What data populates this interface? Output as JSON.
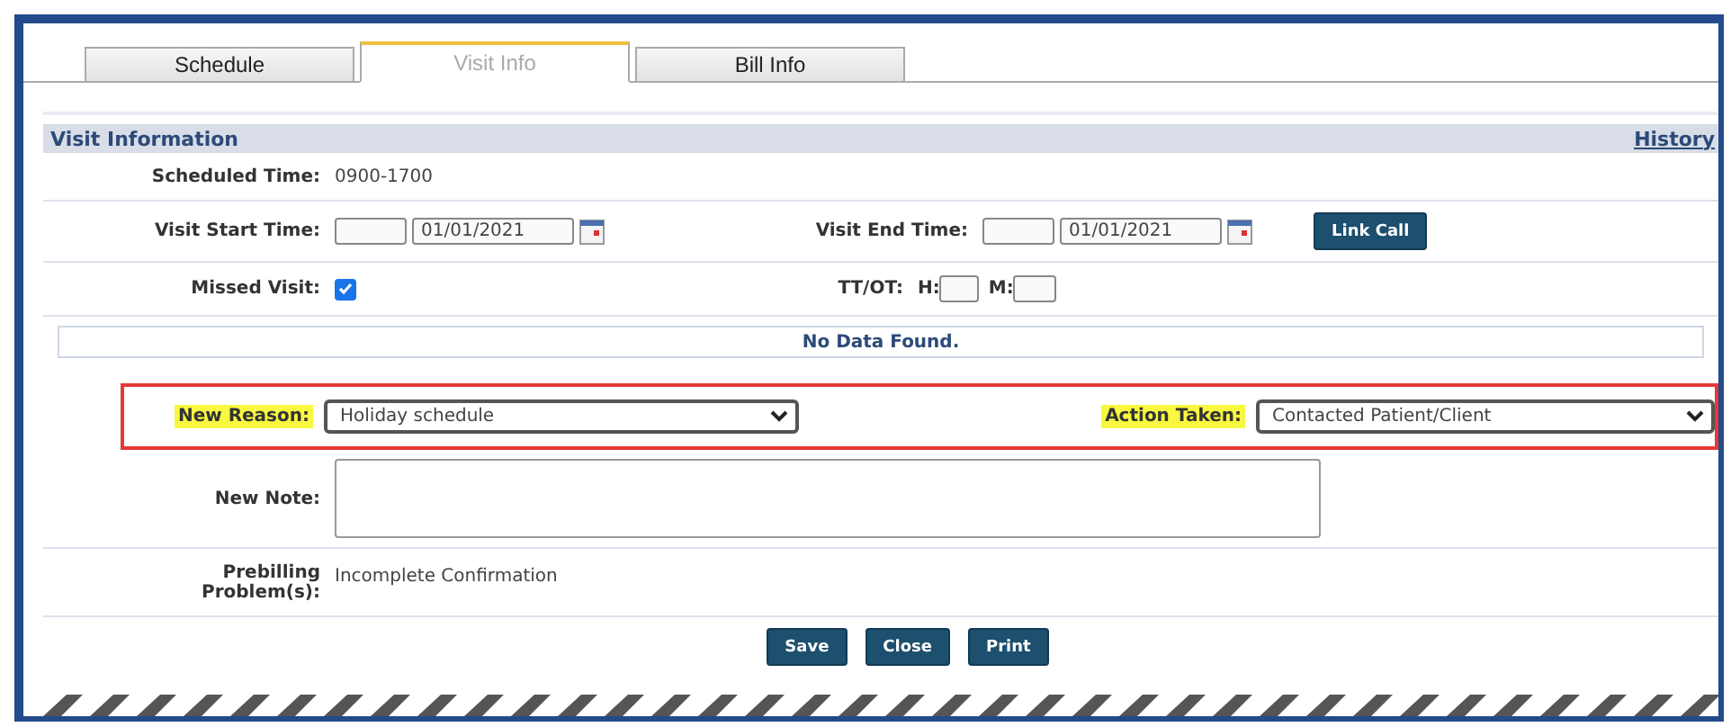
{
  "tabs": [
    {
      "label": "Schedule",
      "selected": false
    },
    {
      "label": "Visit Info",
      "selected": true
    },
    {
      "label": "Bill Info",
      "selected": false
    }
  ],
  "section": {
    "title": "Visit Information",
    "link": "History"
  },
  "scheduled_time": {
    "label": "Scheduled Time:",
    "value": "0900-1700"
  },
  "visit_start": {
    "label": "Visit Start Time:",
    "date": "01/01/2021"
  },
  "visit_end": {
    "label": "Visit End Time:",
    "date": "01/01/2021"
  },
  "link_call": "Link Call",
  "missed_visit": {
    "label": "Missed Visit:",
    "checked": true
  },
  "tt_ot": {
    "label": "TT/OT:",
    "h_label": "H:",
    "m_label": "M:"
  },
  "no_data": "No Data Found.",
  "new_reason": {
    "label": "New Reason:",
    "value": "Holiday schedule",
    "highlighted": true
  },
  "action_taken": {
    "label": "Action Taken:",
    "value": "Contacted Patient/Client",
    "highlighted": true
  },
  "new_note": {
    "label": "New Note:"
  },
  "prebilling": {
    "label": "Prebilling Problem(s):",
    "value": "Incomplete Confirmation"
  },
  "buttons": [
    "Save",
    "Close",
    "Print"
  ]
}
